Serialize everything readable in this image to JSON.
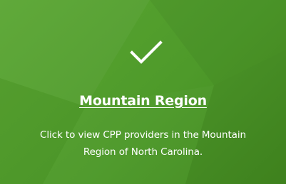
{
  "card": {
    "icon": "checkmark-icon",
    "title": "Mountain Region",
    "description": "Click to view CPP providers in the Mountain Region of North Carolina.",
    "colors": {
      "background": "#4e9a2a",
      "background_light": "#5aa632",
      "background_dark": "#42891f",
      "text": "#ffffff"
    }
  }
}
